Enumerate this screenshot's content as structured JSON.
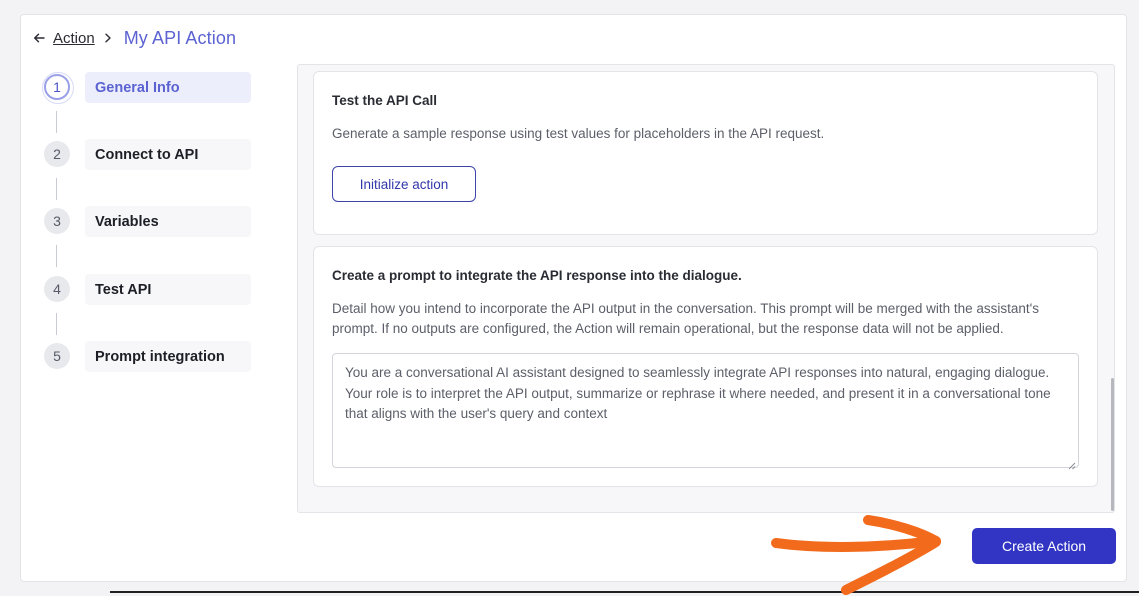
{
  "breadcrumb": {
    "back_label": "Action",
    "title": "My API Action"
  },
  "steps": [
    {
      "number": "1",
      "label": "General Info",
      "active": true
    },
    {
      "number": "2",
      "label": "Connect to API"
    },
    {
      "number": "3",
      "label": "Variables"
    },
    {
      "number": "4",
      "label": "Test API"
    },
    {
      "number": "5",
      "label": "Prompt integration"
    }
  ],
  "test_card": {
    "title": "Test the API Call",
    "description": "Generate a sample response using test values for placeholders in the API request.",
    "button_label": "Initialize action"
  },
  "prompt_card": {
    "title": "Create a prompt to integrate the API response into the dialogue.",
    "description": "Detail how you intend to incorporate the API output in the conversation. This prompt will be merged with the assistant's prompt. If no outputs are configured, the Action will remain operational, but the response data will not be applied.",
    "prompt_value": "You are a conversational AI assistant designed to seamlessly integrate API responses into natural, engaging dialogue. Your role is to interpret the API output, summarize or rephrase it where needed, and present it in a conversational tone that aligns with the user's query and context"
  },
  "footer": {
    "create_label": "Create Action"
  },
  "colors": {
    "accent": "#5b62d1",
    "primary_button": "#3235c4",
    "annotation_arrow": "#f26a1b"
  },
  "icons": {
    "back": "arrow-left-icon",
    "separator": "chevron-right-icon",
    "resize": "resize-handle-icon",
    "annotation": "arrow-annotation"
  }
}
